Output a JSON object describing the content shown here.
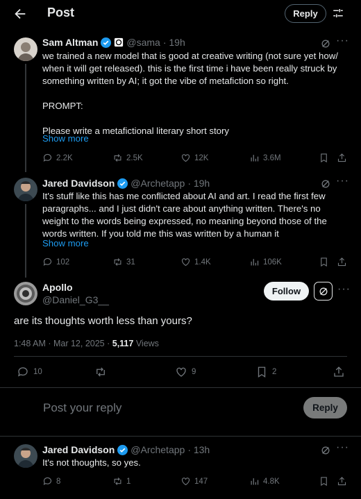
{
  "header": {
    "title": "Post",
    "reply_label": "Reply"
  },
  "tweet1": {
    "name": "Sam Altman",
    "handle": "@sama",
    "time": "· 19h",
    "text": "we trained a new model that is good at creative writing (not sure yet how/ when it will get released). this is the first time i have been really struck by something written by AI; it got the vibe of metafiction so right.\n\nPROMPT:\n\nPlease write a metafictional literary short story",
    "show_more": "Show more",
    "replies": "2.2K",
    "reposts": "2.5K",
    "likes": "12K",
    "views": "3.6M"
  },
  "tweet2": {
    "name": "Jared Davidson",
    "handle": "@Archetapp",
    "time": "· 19h",
    "text": "It's stuff like this has me conflicted about AI and art. I read the first few paragraphs... and I just didn't care about anything written. There's no weight to the words being expressed, no meaning beyond those of the words written. If you told me this was written by a human it",
    "show_more": "Show more",
    "replies": "102",
    "reposts": "31",
    "likes": "1.4K",
    "views": "106K"
  },
  "main": {
    "name": "Apollo",
    "handle": "@Daniel_G3__",
    "follow_label": "Follow",
    "text": "are its thoughts worth less than yours?",
    "timestamp": "1:48 AM · Mar 12, 2025 · ",
    "views_count": "5,117",
    "views_label": " Views",
    "replies": "10",
    "reposts": "",
    "likes": "9",
    "bookmarks": "2"
  },
  "composer": {
    "placeholder": "Post your reply",
    "reply_label": "Reply"
  },
  "tweet3": {
    "name": "Jared Davidson",
    "handle": "@Archetapp",
    "time": "· 13h",
    "text": "It's not thoughts, so yes.",
    "replies": "8",
    "reposts": "1",
    "likes": "147",
    "views": "4.8K"
  },
  "colors": {
    "accent": "#1d9bf0",
    "muted": "#71767b",
    "divider": "#2f3336"
  }
}
